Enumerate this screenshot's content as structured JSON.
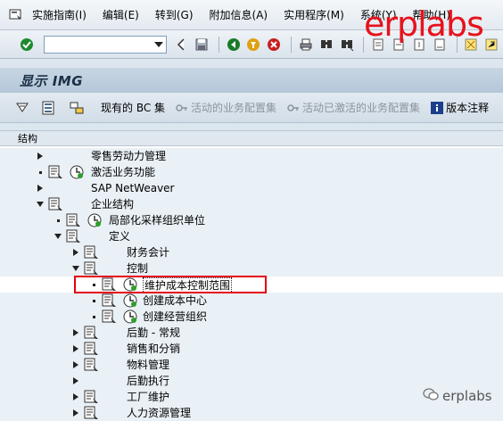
{
  "menu": {
    "items": [
      "实施指南(I)",
      "编辑(E)",
      "转到(G)",
      "附加信息(A)",
      "实用程序(M)",
      "系统(Y)",
      "帮助(H)"
    ]
  },
  "toolbar": {
    "command_value": ""
  },
  "watermark": "erplabs",
  "screen": {
    "title": "显示 IMG"
  },
  "app_toolbar": {
    "existing_bc_sets": "现有的 BC 集",
    "active_bc_sets": "活动的业务配置集",
    "activated_bc_sets": "活动已激活的业务配置集",
    "release_notes": "版本注释"
  },
  "tree": {
    "header": "结构",
    "nodes": [
      {
        "label": "零售劳动力管理"
      },
      {
        "label": "激活业务功能"
      },
      {
        "label": "SAP NetWeaver"
      },
      {
        "label": "企业结构"
      },
      {
        "label": "局部化采样组织单位"
      },
      {
        "label": "定义"
      },
      {
        "label": "财务会计"
      },
      {
        "label": "控制"
      },
      {
        "label": "维护成本控制范围"
      },
      {
        "label": "创建成本中心"
      },
      {
        "label": "创建经营组织"
      },
      {
        "label": "后勤 - 常规"
      },
      {
        "label": "销售和分销"
      },
      {
        "label": "物料管理"
      },
      {
        "label": "后勤执行"
      },
      {
        "label": "工厂维护"
      },
      {
        "label": "人力资源管理"
      }
    ]
  },
  "footer_watermark": "erplabs"
}
